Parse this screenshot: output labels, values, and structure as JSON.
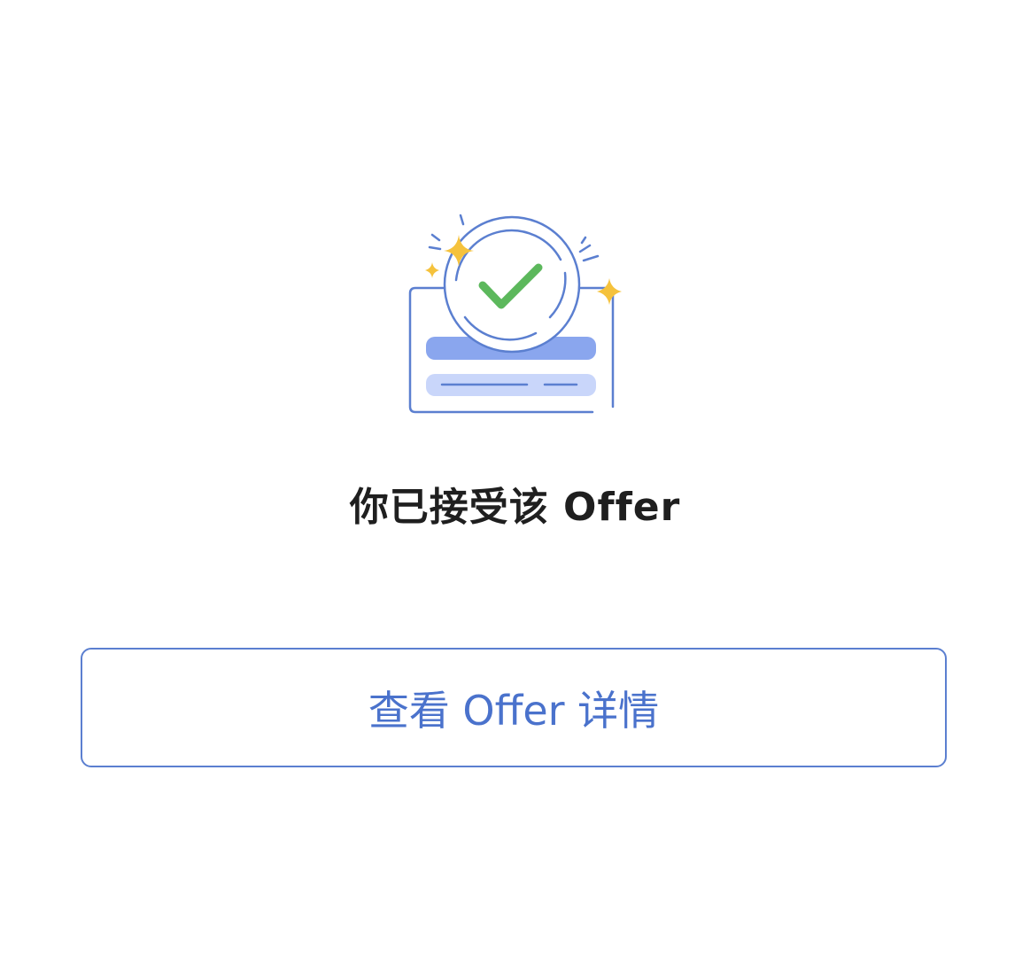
{
  "status": {
    "icon": "offer-accepted-check-icon",
    "title": "你已接受该 Offer"
  },
  "actions": {
    "view_details_label": "查看 Offer 详情"
  },
  "colors": {
    "accent": "#4a72cc",
    "check": "#5cb85c",
    "sparkle": "#f5c23c"
  }
}
